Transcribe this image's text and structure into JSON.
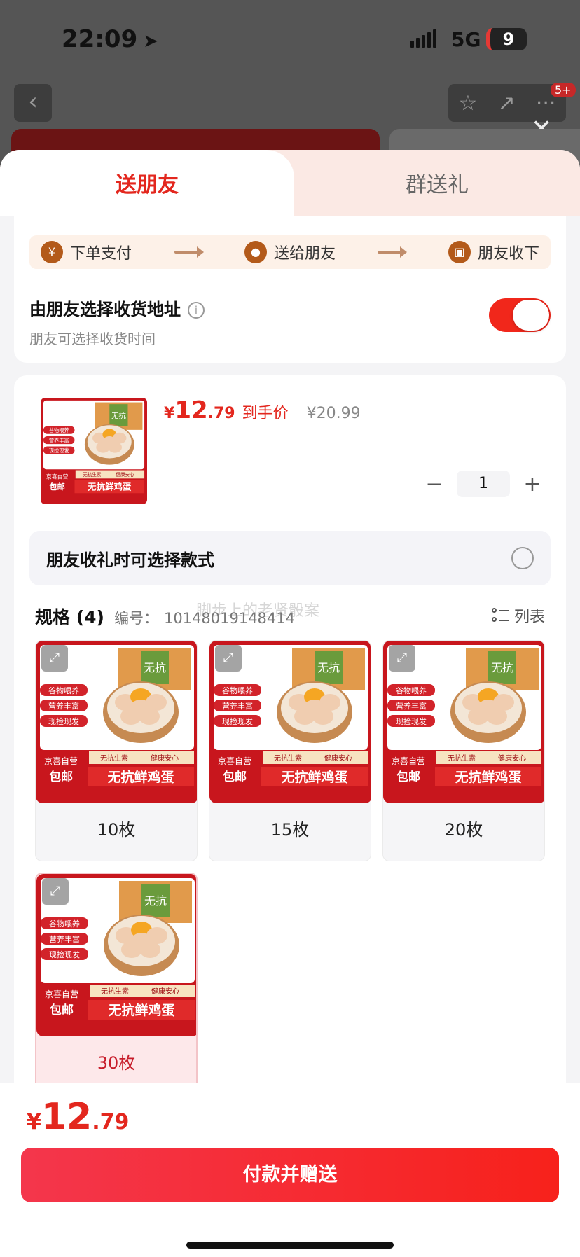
{
  "status": {
    "time": "22:09",
    "network": "5G",
    "battery": "9"
  },
  "nav": {
    "badge": "5+"
  },
  "tabs": {
    "send_friend": "送朋友",
    "group_gift": "群送礼"
  },
  "steps": [
    {
      "icon": "yuan-icon",
      "label": "下单支付"
    },
    {
      "icon": "wechat-icon",
      "label": "送给朋友"
    },
    {
      "icon": "gift-icon",
      "label": "朋友收下"
    }
  ],
  "address": {
    "title": "由朋友选择收货地址",
    "subtitle": "朋友可选择收货时间",
    "toggle_on": true
  },
  "product": {
    "price_currency": "¥",
    "price_int": "12",
    "price_dec": ".79",
    "price_label": "到手价",
    "orig_price": "¥20.99",
    "quantity": "1"
  },
  "choose_style": "朋友收礼时可选择款式",
  "spec": {
    "title": "规格 (4)",
    "no_label": "编号：",
    "no_value": "10148019148414",
    "list_label": "列表"
  },
  "watermark": "脚步上的老贤骰案",
  "product_image": {
    "tags": [
      "谷物喂养",
      "营养丰富",
      "现捡现发"
    ],
    "small_text_1": "无抗生素",
    "small_text_2": "健康安心",
    "store_tag": "京喜自营",
    "shipping_tag": "包邮",
    "name": "无抗鲜鸡蛋",
    "box_text": "无抗"
  },
  "specs": [
    {
      "label": "10枚",
      "selected": false
    },
    {
      "label": "15枚",
      "selected": false
    },
    {
      "label": "20枚",
      "selected": false
    },
    {
      "label": "30枚",
      "selected": true
    }
  ],
  "bottom": {
    "currency": "¥",
    "int": "12",
    "dec": ".79",
    "pay_label": "付款并赠送"
  },
  "colors": {
    "accent": "#e3271e",
    "tab_bg": "#fbe9e4",
    "step_bg": "#fdf1e8"
  }
}
